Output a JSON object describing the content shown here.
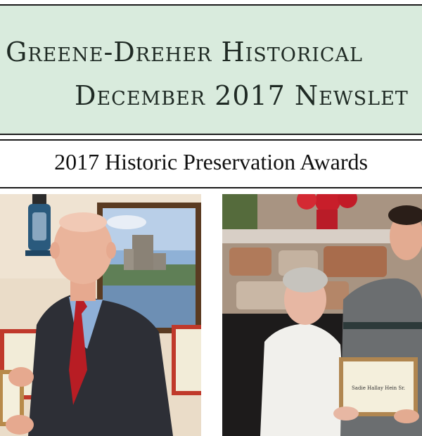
{
  "masthead": {
    "line1": "Greene-Dreher Historical",
    "line2": "December 2017 Newslet"
  },
  "headline": "2017 Historic Preservation Awards",
  "photos": [
    {
      "name": "award-recipient-man-photo"
    },
    {
      "name": "award-recipients-pair-photo"
    }
  ],
  "certificate": {
    "text": "Sadie Hallay Hein Sr."
  }
}
